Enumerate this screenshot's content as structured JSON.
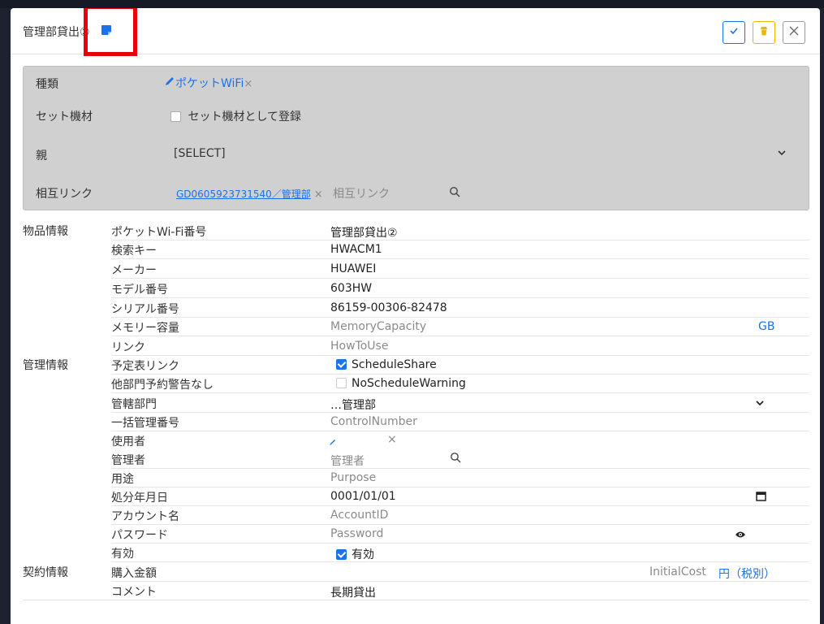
{
  "modal": {
    "title": "管理部貸出②"
  },
  "top_panel": {
    "type_label": "種類",
    "type_value": "ポケットWiFi",
    "set_label": "セット機材",
    "set_checkbox_label": "セット機材として登録",
    "parent_label": "親",
    "parent_value": "[SELECT]",
    "mutual_link_label": "相互リンク",
    "mutual_link_value": "GD0605923731540／管理部",
    "mutual_link_placeholder": "相互リンク"
  },
  "sections": {
    "product_info": "物品情報",
    "management_info": "管理情報",
    "contract_info": "契約情報"
  },
  "product_rows": [
    {
      "label": "ポケットWi-Fi番号",
      "value": "管理部貸出②"
    },
    {
      "label": "検索キー",
      "value": "HWACM1"
    },
    {
      "label": "メーカー",
      "value": "HUAWEI"
    },
    {
      "label": "モデル番号",
      "value": "603HW"
    },
    {
      "label": "シリアル番号",
      "value": "86159-00306-82478"
    },
    {
      "label": "メモリー容量",
      "placeholder": "MemoryCapacity",
      "unit": "GB"
    },
    {
      "label": "リンク",
      "placeholder": "HowToUse"
    }
  ],
  "management_rows": [
    {
      "label": "予定表リンク",
      "checkbox_label": "ScheduleShare",
      "checked": true
    },
    {
      "label": "他部門予約警告なし",
      "checkbox_label": "NoScheduleWarning",
      "checked": false
    },
    {
      "label": "管轄部門",
      "value": "…管理部"
    },
    {
      "label": "一括管理番号",
      "placeholder": "ControlNumber"
    },
    {
      "label": "使用者"
    },
    {
      "label": "管理者",
      "placeholder": "管理者"
    },
    {
      "label": "用途",
      "placeholder": "Purpose"
    },
    {
      "label": "処分年月日",
      "value": "0001/01/01"
    },
    {
      "label": "アカウント名",
      "placeholder": "AccountID"
    },
    {
      "label": "パスワード",
      "placeholder": "Password"
    },
    {
      "label": "有効",
      "checkbox_label": "有効",
      "checked": true
    }
  ],
  "contract_rows": [
    {
      "label": "購入金額",
      "placeholder": "InitialCost",
      "unit": "円（税別）"
    },
    {
      "label": "コメント",
      "value": "長期貸出"
    }
  ],
  "colors": {
    "accent": "#1a73e8",
    "warning": "#f0b400",
    "highlight": "#e8000b",
    "panel": "#d0d0d0"
  }
}
